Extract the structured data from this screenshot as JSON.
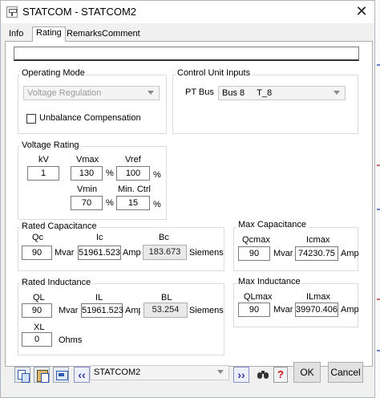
{
  "window": {
    "title": "STATCOM - STATCOM2"
  },
  "tabs": [
    "Info",
    "Rating",
    "Remarks",
    "Comment"
  ],
  "name_field": {
    "value": ""
  },
  "operating_mode": {
    "title": "Operating Mode",
    "mode": "Voltage Regulation",
    "unbalance_label": "Unbalance Compensation",
    "unbalance_checked": false
  },
  "control_unit": {
    "title": "Control Unit Inputs",
    "pt_bus_label": "PT Bus",
    "pt_bus_value": "Bus 8     T_8"
  },
  "voltage_rating": {
    "title": "Voltage Rating",
    "kv_label": "kV",
    "kv": "1",
    "vmax_label": "Vmax",
    "vmax": "130",
    "vref_label": "Vref",
    "vref": "100",
    "vmin_label": "Vmin",
    "vmin": "70",
    "minctrl_label": "Min. Ctrl",
    "minctrl": "15",
    "pct": "%"
  },
  "rated_capacitance": {
    "title": "Rated Capacitance",
    "qc_label": "Qc",
    "qc": "90",
    "qc_unit": "Mvar",
    "ic_label": "Ic",
    "ic": "51961.523",
    "ic_unit": "Amp",
    "bc_label": "Bc",
    "bc": "183.673",
    "bc_unit": "Siemens"
  },
  "max_capacitance": {
    "title": "Max Capacitance",
    "qcmax_label": "Qcmax",
    "qcmax": "90",
    "qcmax_unit": "Mvar",
    "icmax_label": "Icmax",
    "icmax": "74230.75",
    "icmax_unit": "Amp"
  },
  "rated_inductance": {
    "title": "Rated Inductance",
    "ql_label": "QL",
    "ql": "90",
    "ql_unit": "Mvar",
    "il_label": "IL",
    "il": "51961.523",
    "il_unit": "Amp",
    "bl_label": "BL",
    "bl": "53.254",
    "bl_unit": "Siemens",
    "xl_label": "XL",
    "xl": "0",
    "xl_unit": "Ohms"
  },
  "max_inductance": {
    "title": "Max Inductance",
    "qlmax_label": "QLmax",
    "qlmax": "90",
    "qlmax_unit": "Mvar",
    "ilmax_label": "ILmax",
    "ilmax": "39970.406",
    "ilmax_unit": "Amp"
  },
  "footer": {
    "element_selector": "STATCOM2",
    "ok_label": "OK",
    "cancel_label": "Cancel",
    "help_label": "?"
  }
}
